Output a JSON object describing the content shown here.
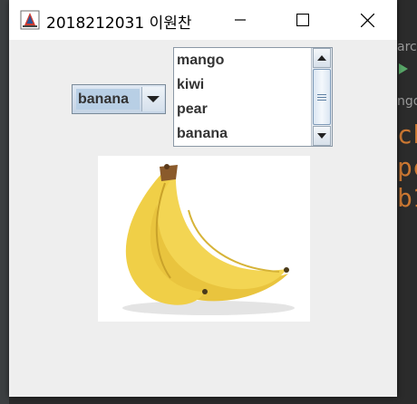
{
  "window": {
    "title": "2018212031 이원찬"
  },
  "combo": {
    "selected": "banana",
    "arrow_icon": "chevron-down-icon"
  },
  "list": {
    "items": [
      "mango",
      "kiwi",
      "pear",
      "banana"
    ]
  },
  "image": {
    "subject": "banana-image"
  },
  "colors": {
    "titlebar": "#ffffff",
    "content": "#eeeeee",
    "combo_selected_bg": "#b8cfe5",
    "banana_yellow": "#f2d04c",
    "ide_orange": "#cc7832"
  }
}
